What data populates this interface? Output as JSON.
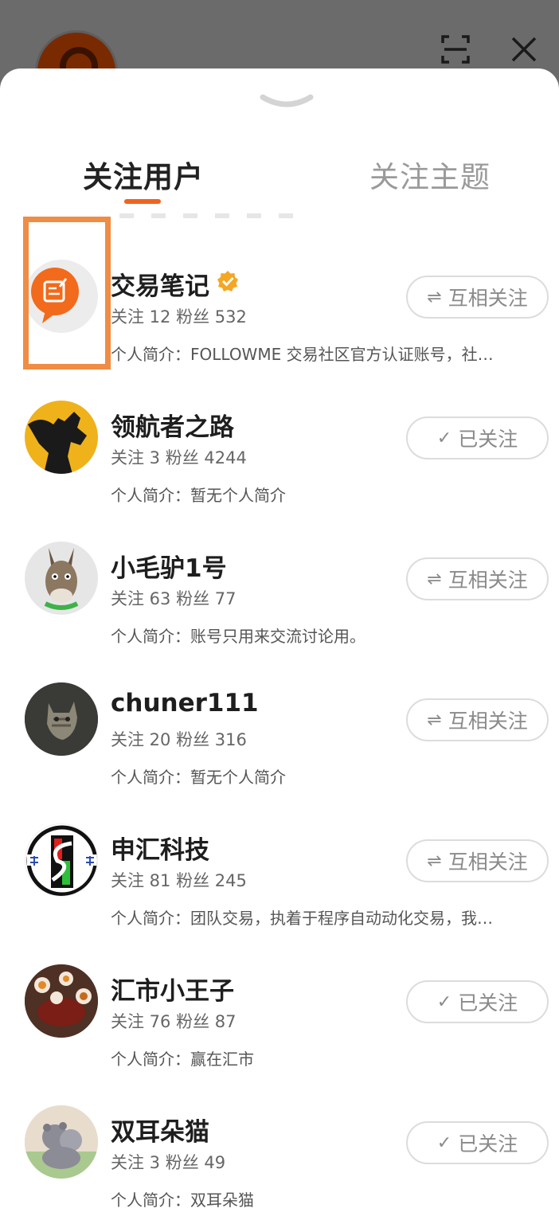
{
  "tabs": {
    "following_users": "关注用户",
    "following_topics": "关注主题"
  },
  "colors": {
    "accent": "#f0641e",
    "verified": "#f5a623",
    "highlight": "#f08c43"
  },
  "users": [
    {
      "name": "交易笔记",
      "verified": true,
      "stats": "关注 12 粉丝 532",
      "bio": "个人简介：FOLLOWME 交易社区官方认证账号，社…",
      "button_glyph": "⇌",
      "button_label": "互相关注"
    },
    {
      "name": "领航者之路",
      "verified": false,
      "stats": "关注 3 粉丝 4244",
      "bio": "个人简介：暂无个人简介",
      "button_glyph": "✓",
      "button_label": "已关注"
    },
    {
      "name": "小毛驴1号",
      "verified": false,
      "stats": "关注 63 粉丝 77",
      "bio": "个人简介：账号只用来交流讨论用。",
      "button_glyph": "⇌",
      "button_label": "互相关注"
    },
    {
      "name": "chuner111",
      "verified": false,
      "stats": "关注 20 粉丝 316",
      "bio": "个人简介：暂无个人简介",
      "button_glyph": "⇌",
      "button_label": "互相关注"
    },
    {
      "name": "申汇科技",
      "verified": false,
      "stats": "关注 81 粉丝 245",
      "bio": "个人简介：团队交易，执着于程序自动动化交易，我…",
      "button_glyph": "⇌",
      "button_label": "互相关注"
    },
    {
      "name": "汇市小王子",
      "verified": false,
      "stats": "关注 76 粉丝 87",
      "bio": "个人简介：赢在汇市",
      "button_glyph": "✓",
      "button_label": "已关注"
    },
    {
      "name": "双耳朵猫",
      "verified": false,
      "stats": "关注 3 粉丝 49",
      "bio": "个人简介：双耳朵猫",
      "button_glyph": "✓",
      "button_label": "已关注"
    }
  ]
}
